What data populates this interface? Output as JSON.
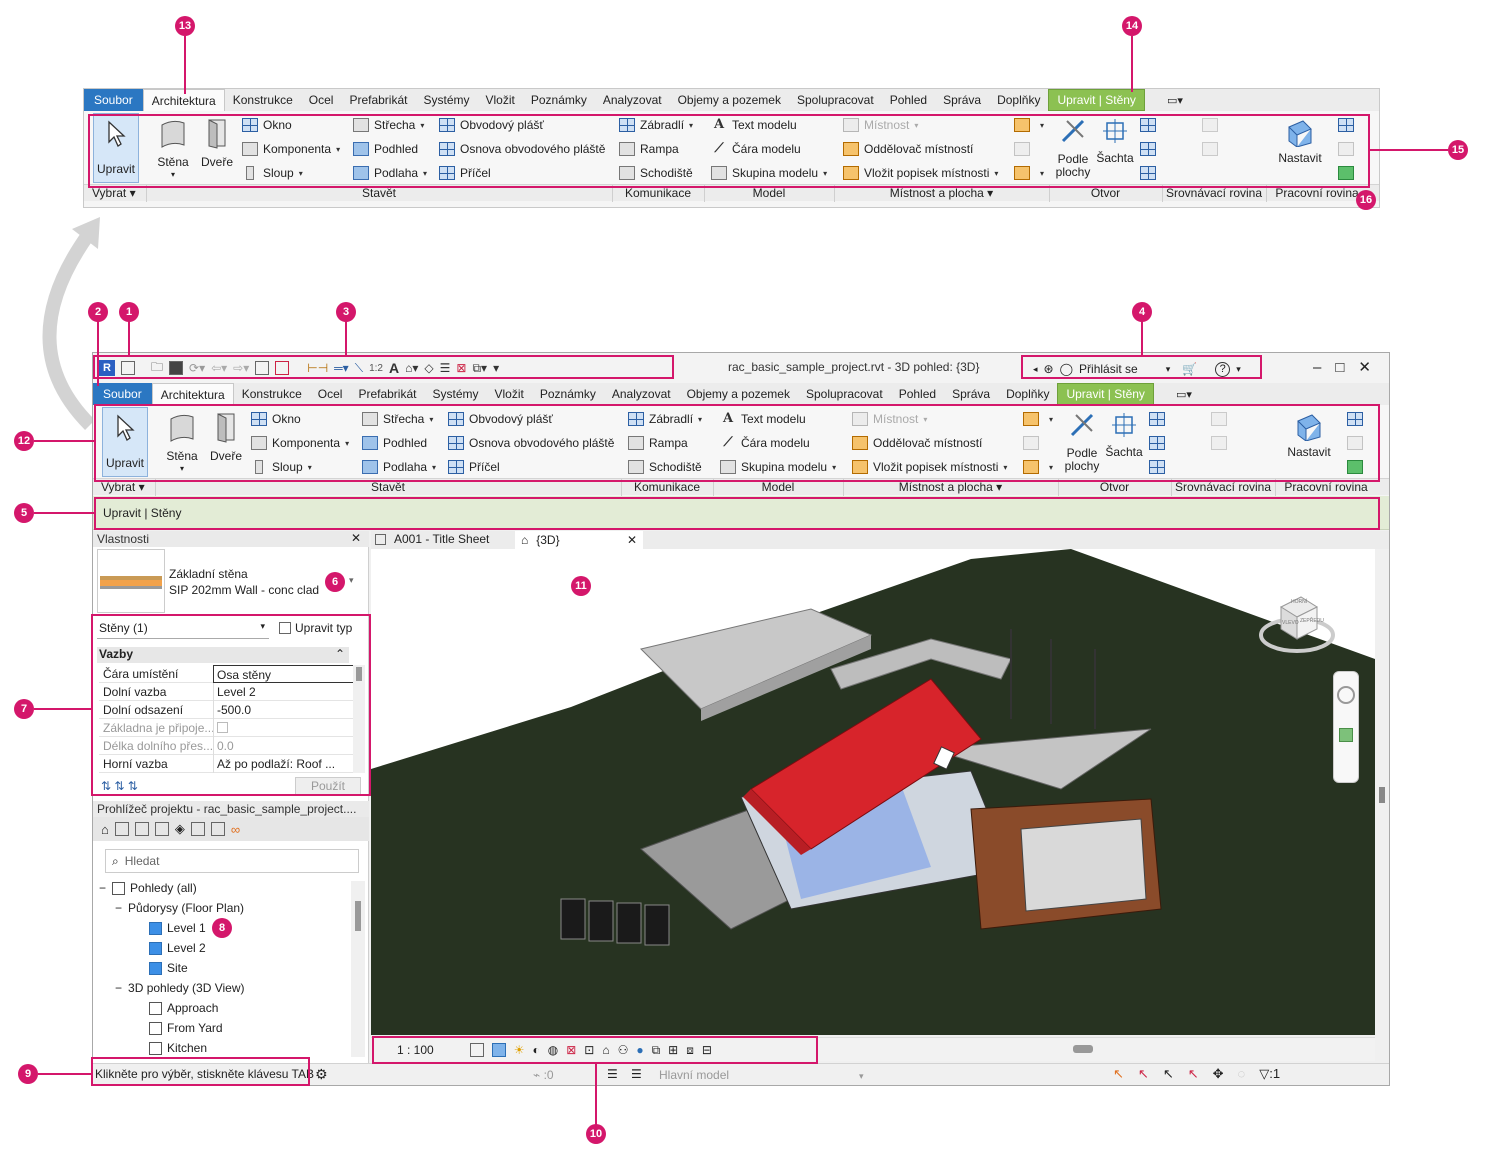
{
  "ribbon": {
    "tabs": [
      "Soubor",
      "Architektura",
      "Konstrukce",
      "Ocel",
      "Prefabrikát",
      "Systémy",
      "Vložit",
      "Poznámky",
      "Analyzovat",
      "Objemy a pozemek",
      "Spolupracovat",
      "Pohled",
      "Správa",
      "Doplňky",
      "Upravit | Stěny"
    ],
    "more": "▭▾",
    "select": {
      "label": "Upravit",
      "group": "Vybrat"
    },
    "build": {
      "big": [
        "Stěna",
        "Dveře"
      ],
      "col1": [
        "Okno",
        "Komponenta",
        "Sloup"
      ],
      "col2": [
        "Střecha",
        "Podhled",
        "Podlaha"
      ],
      "col3": [
        "Obvodový plášť",
        "Osnova obvodového pláště",
        "Příčel"
      ],
      "group": "Stavět"
    },
    "circulation": {
      "items": [
        "Zábradlí",
        "Rampa",
        "Schodiště"
      ],
      "group": "Komunikace"
    },
    "model": {
      "items": [
        "Text modelu",
        "Čára  modelu",
        "Skupina modelu"
      ],
      "group": "Model"
    },
    "room": {
      "items": [
        "Místnost",
        "Oddělovač  místností",
        "Vložit popisek  místnosti"
      ],
      "group": "Místnost a plocha"
    },
    "opening": {
      "big1": "Podle plochy",
      "big2": "Šachta",
      "group": "Otvor"
    },
    "datum": {
      "group": "Srovnávací rovina"
    },
    "workplane": {
      "big": "Nastavit",
      "group": "Pracovní rovina"
    }
  },
  "window": {
    "title": "rac_basic_sample_project.rvt - 3D pohled: {3D}",
    "signin": "Přihlásit se",
    "help": "?",
    "context_label": "Upravit | Stěny"
  },
  "properties": {
    "title": "Vlastnosti",
    "type_family": "Základní stěna",
    "type_name": "SIP 202mm Wall - conc clad",
    "filter": "Stěny (1)",
    "edit_type": "Upravit typ",
    "section": "Vazby",
    "rows": [
      {
        "k": "Čára umístění",
        "v": "Osa stěny"
      },
      {
        "k": "Dolní vazba",
        "v": "Level 2"
      },
      {
        "k": "Dolní odsazení",
        "v": "-500.0"
      },
      {
        "k": "Základna je připoje...",
        "v": ""
      },
      {
        "k": "Délka dolního přes...",
        "v": "0.0"
      },
      {
        "k": "Horní vazba",
        "v": "Až po podlaží: Roof ..."
      }
    ],
    "apply": "Použít"
  },
  "browser": {
    "title": "Prohlížeč projektu - rac_basic_sample_project....",
    "search_placeholder": "Hledat",
    "views": "Pohledy (all)",
    "floor_plans": "Půdorysy (Floor Plan)",
    "plans": [
      "Level 1",
      "Level 2",
      "Site"
    ],
    "views3d": "3D pohledy (3D View)",
    "views3d_items": [
      "Approach",
      "From Yard",
      "Kitchen"
    ]
  },
  "view_tabs": [
    "A001 - Title Sheet",
    "{3D}"
  ],
  "viewcube": {
    "top": "HORNÍ",
    "left": "VLEVO",
    "front": "ZEPŘEDU"
  },
  "view_toolbar": {
    "scale": "1 : 100"
  },
  "status": {
    "message": "Klikněte pro výběr, stiskněte klávesu TAB",
    "workset_count": ":0",
    "model": "Hlavní model",
    "filter_count": ":1"
  },
  "tag_label": "1:2",
  "callouts": [
    "1",
    "2",
    "3",
    "4",
    "5",
    "6",
    "7",
    "8",
    "9",
    "10",
    "11",
    "12",
    "13",
    "14",
    "15",
    "16"
  ],
  "colors": {
    "accent": "#d4176b",
    "file_tab": "#2b77c2",
    "context_tab": "#8cc152",
    "roof": "#d7242b",
    "terrain": "#2b3a1f"
  }
}
